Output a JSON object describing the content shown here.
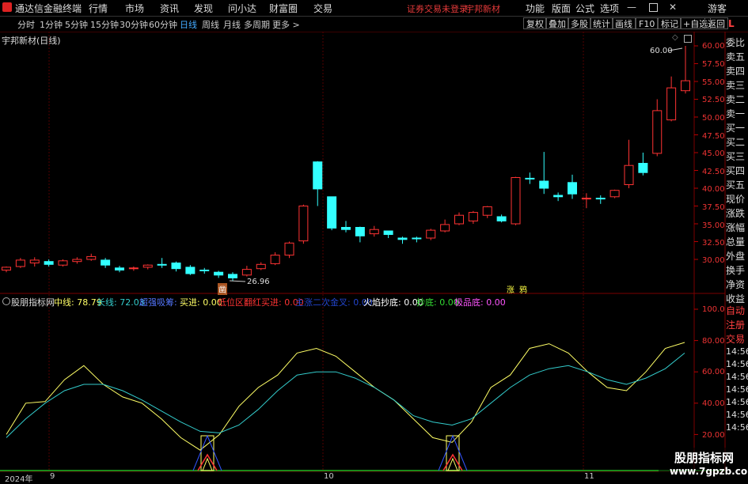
{
  "menu": {
    "app_title": "通达信金融终端",
    "items": [
      "行情",
      "市场",
      "资讯",
      "发现",
      "问小达",
      "财富圈",
      "交易"
    ],
    "notice": "证券交易未登录",
    "stock": "宇邦新材",
    "right_items": [
      "功能",
      "版面",
      "公式",
      "选项"
    ],
    "user": "游客"
  },
  "toolbar": {
    "periods": [
      "分时",
      "1分钟",
      "5分钟",
      "15分钟",
      "30分钟",
      "60分钟",
      "日线",
      "周线",
      "月线",
      "多周期",
      "更多 >"
    ],
    "active_period": "日线",
    "buttons": [
      "复权",
      "叠加",
      "多股",
      "统计",
      "画线",
      "F10",
      "标记",
      "+自选",
      "返回"
    ]
  },
  "chart_header": {
    "title": "宇邦新材(日线)",
    "high_label": "60.00",
    "low_label": "26.96",
    "markers": [
      "凿",
      "涨",
      "鸦"
    ]
  },
  "right_panel": {
    "top_letter": "L",
    "labels": [
      "委比",
      "卖五",
      "卖四",
      "卖三",
      "卖二",
      "卖一",
      "买一",
      "买二",
      "买三",
      "买四",
      "买五",
      "现价",
      "涨跌",
      "涨幅",
      "总量",
      "外盘",
      "换手",
      "净资",
      "收益",
      "自动",
      "注册",
      "交易"
    ],
    "lower_labels": [
      "自动",
      "注册",
      "交易"
    ],
    "time_labels": [
      "14:56",
      "14:56",
      "14:56",
      "14:56",
      "14:56",
      "14:56",
      "14:56"
    ]
  },
  "price_axis": [
    "60.00",
    "57.50",
    "55.00",
    "52.50",
    "50.00",
    "47.50",
    "45.00",
    "42.50",
    "40.00",
    "37.50",
    "35.00",
    "32.50",
    "30.00"
  ],
  "ind_axis": [
    "100.0",
    "80.00",
    "60.00",
    "40.00",
    "20.00"
  ],
  "indicator": {
    "name": "股朋指标网",
    "mid": "中线: 78.79",
    "long": "长线: 72.03",
    "oversold": "超强吸筹: -",
    "buy": "买进: 0.00",
    "low_red": "低位区翻红买进: 0.00",
    "twice": "主涨二次金叉: 0.00",
    "fire": "火焰抄底: 0.00",
    "bottom": "抄底: 0.00",
    "extreme": "极品底: 0.00"
  },
  "date_axis": [
    "2024年",
    "9",
    "10",
    "11"
  ],
  "watermark": {
    "line1": "股朋指标网",
    "line2": "www.7gpzb.com"
  },
  "chart_data": {
    "type": "candlestick",
    "title": "宇邦新材(日线)",
    "ylim": [
      27,
      61
    ],
    "candles": [
      [
        28.5,
        28.9,
        28.2,
        29.0
      ],
      [
        29.0,
        29.9,
        28.8,
        30.2
      ],
      [
        29.5,
        29.9,
        29.0,
        30.3
      ],
      [
        29.7,
        29.3,
        29.0,
        30.0
      ],
      [
        29.2,
        29.8,
        29.0,
        30.0
      ],
      [
        29.7,
        30.0,
        29.4,
        30.3
      ],
      [
        30.0,
        30.4,
        29.8,
        30.8
      ],
      [
        29.9,
        29.2,
        28.8,
        30.2
      ],
      [
        28.8,
        28.5,
        28.2,
        29.1
      ],
      [
        28.7,
        28.8,
        28.4,
        29.0
      ],
      [
        28.9,
        29.2,
        28.6,
        29.3
      ],
      [
        29.3,
        29.2,
        28.8,
        30.2
      ],
      [
        29.5,
        28.7,
        28.3,
        29.7
      ],
      [
        28.9,
        28.0,
        27.8,
        29.2
      ],
      [
        28.5,
        28.4,
        28.0,
        28.8
      ],
      [
        28.2,
        27.8,
        27.4,
        28.4
      ],
      [
        27.9,
        27.4,
        26.96,
        28.2
      ],
      [
        27.8,
        28.6,
        27.6,
        29.1
      ],
      [
        28.7,
        29.3,
        28.5,
        29.6
      ],
      [
        29.4,
        30.6,
        29.2,
        31.0
      ],
      [
        30.6,
        32.3,
        30.2,
        32.5
      ],
      [
        32.6,
        37.5,
        32.2,
        37.7
      ],
      [
        43.7,
        39.9,
        37.5,
        43.8
      ],
      [
        38.8,
        34.4,
        34.1,
        38.8
      ],
      [
        34.5,
        34.2,
        33.8,
        35.4
      ],
      [
        34.5,
        33.3,
        32.4,
        34.6
      ],
      [
        33.6,
        34.2,
        33.2,
        34.7
      ],
      [
        34.0,
        33.5,
        33.0,
        34.0
      ],
      [
        33.0,
        32.8,
        32.2,
        33.2
      ],
      [
        33.0,
        32.9,
        32.4,
        33.2
      ],
      [
        33.0,
        34.1,
        32.7,
        34.3
      ],
      [
        34.0,
        34.9,
        33.8,
        35.6
      ],
      [
        35.0,
        36.2,
        34.8,
        36.6
      ],
      [
        35.4,
        36.6,
        35.0,
        36.8
      ],
      [
        36.2,
        37.4,
        35.8,
        37.5
      ],
      [
        36.0,
        35.4,
        35.2,
        36.3
      ],
      [
        35.0,
        41.5,
        34.8,
        41.6
      ],
      [
        41.4,
        41.3,
        40.6,
        42.2
      ],
      [
        41.0,
        40.0,
        39.2,
        45.1
      ],
      [
        39.0,
        38.8,
        38.2,
        39.4
      ],
      [
        40.8,
        39.2,
        38.5,
        41.9
      ],
      [
        38.5,
        38.6,
        37.2,
        39.3
      ],
      [
        38.6,
        38.5,
        37.8,
        39.0
      ],
      [
        38.8,
        39.7,
        38.6,
        39.8
      ],
      [
        40.5,
        43.2,
        40.0,
        46.8
      ],
      [
        43.5,
        42.2,
        41.8,
        45.0
      ],
      [
        44.9,
        50.9,
        44.5,
        52.5
      ],
      [
        49.6,
        54.1,
        49.4,
        55.7
      ],
      [
        53.7,
        55.1,
        53.3,
        60.0
      ]
    ],
    "indicator_series": [
      {
        "name": "中线",
        "values": [
          20,
          40,
          41,
          55,
          64,
          52,
          44,
          40,
          30,
          18,
          10,
          20,
          38,
          50,
          58,
          72,
          75,
          70,
          60,
          50,
          42,
          30,
          18,
          15,
          28,
          50,
          58,
          75,
          78,
          72,
          60,
          50,
          48,
          60,
          75,
          78.79
        ]
      },
      {
        "name": "长线",
        "values": [
          18,
          30,
          40,
          48,
          52,
          52,
          48,
          42,
          35,
          28,
          22,
          21,
          26,
          36,
          48,
          58,
          60,
          60,
          56,
          50,
          42,
          32,
          28,
          26,
          30,
          40,
          50,
          58,
          62,
          64,
          60,
          55,
          52,
          56,
          62,
          72.03
        ]
      }
    ],
    "ind_ylim": [
      10,
      100
    ]
  }
}
